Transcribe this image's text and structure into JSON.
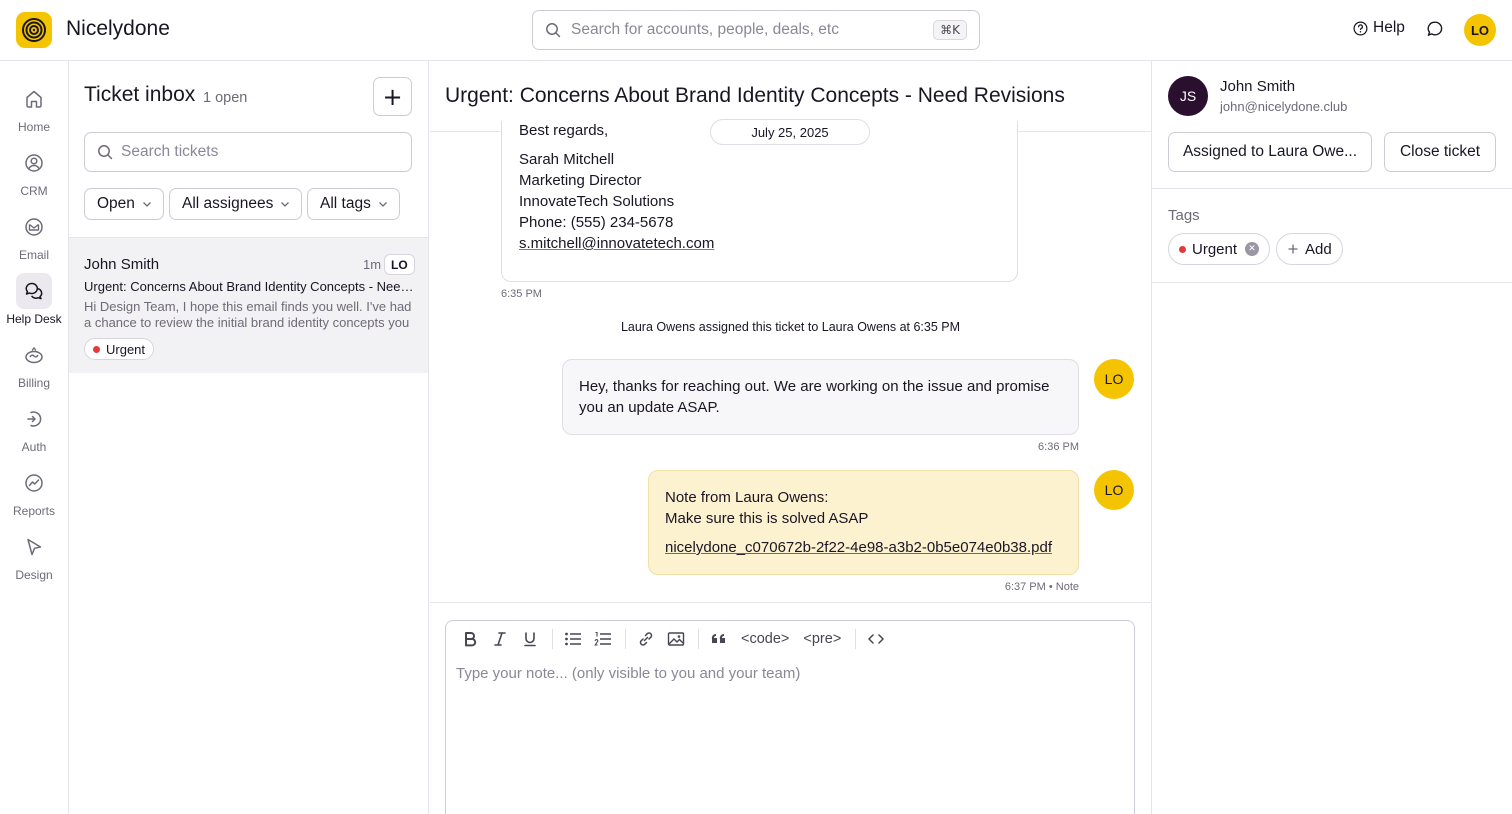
{
  "app": {
    "name": "Nicelydone",
    "search_placeholder": "Search for accounts, people, deals, etc",
    "search_shortcut": "⌘K",
    "help_label": "Help",
    "user_initials": "LO",
    "accent_color": "#f5c400"
  },
  "nav": {
    "items": [
      {
        "label": "Home",
        "icon": "home-icon"
      },
      {
        "label": "CRM",
        "icon": "crm-icon"
      },
      {
        "label": "Email",
        "icon": "email-icon"
      },
      {
        "label": "Help Desk",
        "icon": "help-desk-icon",
        "active": true
      },
      {
        "label": "Billing",
        "icon": "billing-icon"
      },
      {
        "label": "Auth",
        "icon": "auth-icon"
      },
      {
        "label": "Reports",
        "icon": "reports-icon"
      },
      {
        "label": "Design",
        "icon": "design-icon"
      }
    ]
  },
  "inbox": {
    "title": "Ticket inbox",
    "count": "1 open",
    "add_label": "+",
    "search_placeholder": "Search tickets",
    "filters": {
      "status": "Open",
      "assignee": "All assignees",
      "tags": "All tags"
    },
    "tickets": [
      {
        "name": "John Smith",
        "time": "1m",
        "assignee": "LO",
        "subject": "Urgent: Concerns About Brand Identity Concepts - Need Revisions",
        "preview": "Hi Design Team, I hope this email finds you well. I've had a chance to review the initial brand identity concepts you presented",
        "tag": "Urgent"
      }
    ]
  },
  "conversation": {
    "title": "Urgent: Concerns About Brand Identity Concepts - Need Revisions",
    "date": "July 25, 2025",
    "email": {
      "closing": "Best regards,",
      "sender_name": "Sarah Mitchell",
      "sender_title": "Marketing Director",
      "company": "InnovateTech Solutions",
      "phone": "Phone: (555) 234-5678",
      "email": "s.mitchell@innovatetech.com",
      "time": "6:35 PM"
    },
    "system_message": "Laura Owens assigned this ticket to Laura Owens at 6:35 PM",
    "reply": {
      "text": "Hey, thanks for reaching out. We are working on the issue and promise you an update ASAP.",
      "time": "6:36 PM",
      "initials": "LO"
    },
    "note": {
      "heading": "Note from Laura Owens:",
      "text": "Make sure this is solved ASAP",
      "attachment": "nicelydone_c070672b-2f22-4e98-a3b2-0b5e074e0b38.pdf",
      "time": "6:37 PM • Note",
      "initials": "LO",
      "bg_color": "#fdf2d0"
    },
    "composer": {
      "placeholder": "Type your note... (only visible to you and your team)",
      "code_label": "<code>",
      "pre_label": "<pre>"
    }
  },
  "contact": {
    "initials": "JS",
    "name": "John Smith",
    "email": "john@nicelydone.club",
    "assign_label": "Assigned to Laura Owe...",
    "close_label": "Close ticket",
    "tags_label": "Tags",
    "tags": [
      "Urgent"
    ],
    "add_tag_label": "Add",
    "tag_color": "#e5383b"
  }
}
